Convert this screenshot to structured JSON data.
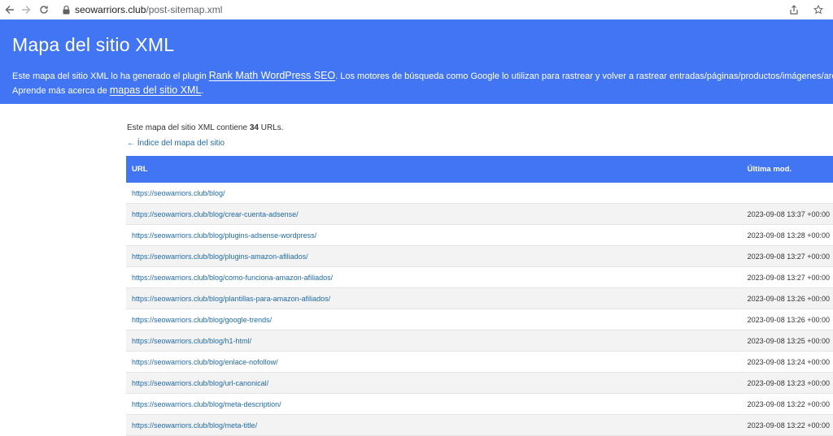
{
  "browser": {
    "url_domain": "seowarriors.club",
    "url_path": "/post-sitemap.xml"
  },
  "header": {
    "title": "Mapa del sitio XML",
    "line1_prefix": "Este mapa del sitio XML lo ha generado el plugin ",
    "line1_link": "Rank Math WordPress SEO",
    "line1_suffix": ". Los motores de búsqueda como Google lo utilizan para rastrear y volver a rastrear entradas/páginas/productos/imágenes/archivos de tu web.",
    "line2_prefix": "Aprende más acerca de ",
    "line2_link": "mapas del sitio XML",
    "line2_suffix": "."
  },
  "summary": {
    "prefix": "Este mapa del sitio XML contiene ",
    "count": "34",
    "suffix": " URLs."
  },
  "index_link": "← Índice del mapa del sitio",
  "table": {
    "col_url": "URL",
    "col_mod": "Última mod.",
    "rows": [
      {
        "url": "https://seowarriors.club/blog/",
        "mod": ""
      },
      {
        "url": "https://seowarriors.club/blog/crear-cuenta-adsense/",
        "mod": "2023-09-08 13:37 +00:00"
      },
      {
        "url": "https://seowarriors.club/blog/plugins-adsense-wordpress/",
        "mod": "2023-09-08 13:28 +00:00"
      },
      {
        "url": "https://seowarriors.club/blog/plugins-amazon-afiliados/",
        "mod": "2023-09-08 13:27 +00:00"
      },
      {
        "url": "https://seowarriors.club/blog/como-funciona-amazon-afiliados/",
        "mod": "2023-09-08 13:27 +00:00"
      },
      {
        "url": "https://seowarriors.club/blog/plantillas-para-amazon-afiliados/",
        "mod": "2023-09-08 13:26 +00:00"
      },
      {
        "url": "https://seowarriors.club/blog/google-trends/",
        "mod": "2023-09-08 13:26 +00:00"
      },
      {
        "url": "https://seowarriors.club/blog/h1-html/",
        "mod": "2023-09-08 13:25 +00:00"
      },
      {
        "url": "https://seowarriors.club/blog/enlace-nofollow/",
        "mod": "2023-09-08 13:24 +00:00"
      },
      {
        "url": "https://seowarriors.club/blog/url-canonical/",
        "mod": "2023-09-08 13:23 +00:00"
      },
      {
        "url": "https://seowarriors.club/blog/meta-description/",
        "mod": "2023-09-08 13:22 +00:00"
      },
      {
        "url": "https://seowarriors.club/blog/meta-title/",
        "mod": "2023-09-08 13:22 +00:00"
      }
    ]
  },
  "colors": {
    "header_bg": "#4275f4",
    "link": "#1f6aa5"
  }
}
